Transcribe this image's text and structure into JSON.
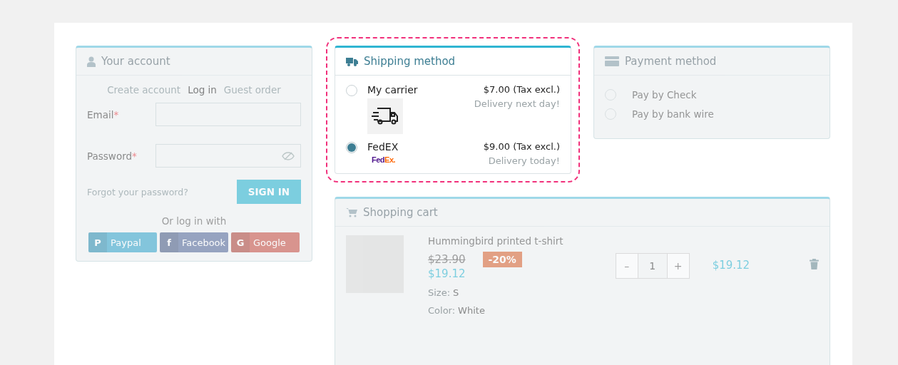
{
  "account": {
    "title": "Your account",
    "highlighted": false,
    "tabs": [
      {
        "label": "Create account",
        "selected": false
      },
      {
        "label": "Log in",
        "selected": true
      },
      {
        "label": "Guest order",
        "selected": false
      }
    ],
    "fields": [
      {
        "kind": "text",
        "label": "Email",
        "required_mark": "*"
      },
      {
        "kind": "password",
        "label": "Password",
        "required_mark": "*"
      }
    ],
    "forgot_link": "Forgot your password?",
    "sign_in": "SIGN IN",
    "social_heading": "Or log in with",
    "social": [
      {
        "glyph": "P",
        "label": "Paypal"
      },
      {
        "glyph": "f",
        "label": "Facebook"
      },
      {
        "glyph": "G",
        "label": "Google"
      }
    ]
  },
  "shipping": {
    "title": "Shipping method",
    "highlighted": true,
    "carriers": [
      {
        "name": "My carrier",
        "price": "$7.00 (Tax excl.)",
        "delay": "Delivery next day!",
        "selected": false,
        "logo": {
          "kind": "image"
        }
      },
      {
        "name": "FedEX",
        "price": "$9.00 (Tax excl.)",
        "delay": "Delivery today!",
        "selected": true,
        "logo": {
          "kind": "wordmark",
          "parts": [
            "Fed",
            "Ex."
          ]
        }
      }
    ]
  },
  "payment": {
    "title": "Payment method",
    "highlighted": false,
    "options": [
      {
        "label": "Pay by Check",
        "selected": false
      },
      {
        "label": "Pay by bank wire",
        "selected": false
      }
    ]
  },
  "cart": {
    "title": "Shopping cart",
    "highlighted": false,
    "items": [
      {
        "name": "Hummingbird printed t-shirt",
        "old_price": "$23.90",
        "discount": "-20%",
        "price": "$19.12",
        "attributes": [
          {
            "label": "Size:",
            "value": "S"
          },
          {
            "label": "Color:",
            "value": "White"
          }
        ],
        "minus": "–",
        "quantity": "1",
        "plus": "+",
        "total": "$19.12"
      }
    ]
  }
}
